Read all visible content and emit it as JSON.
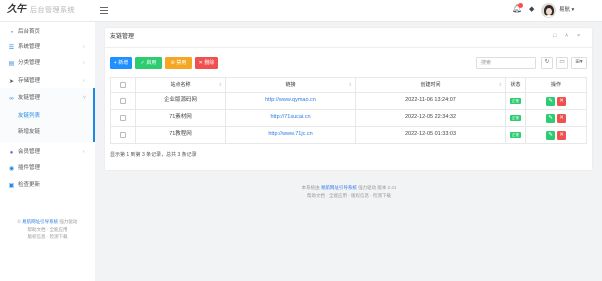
{
  "app": {
    "logo_text": "久午",
    "title": "后台管理系统"
  },
  "header": {
    "menu_icon": "hamburger-icon",
    "notification_icon": "bell-icon",
    "theme_icon": "skin-icon",
    "user_name": "易航",
    "user_caret": "▾"
  },
  "sidebar": {
    "items": [
      {
        "label": "后台首页",
        "icon": "dashboard-icon"
      },
      {
        "label": "系统管理",
        "icon": "sliders-icon"
      },
      {
        "label": "分类管理",
        "icon": "list-icon"
      },
      {
        "label": "存储管理",
        "icon": "send-icon"
      },
      {
        "label": "友链管理",
        "icon": "link-icon",
        "expanded": true,
        "children": [
          {
            "label": "友链列表",
            "active": true
          },
          {
            "label": "新增友链"
          }
        ]
      },
      {
        "label": "会员管理",
        "icon": "users-icon"
      },
      {
        "label": "插件管理",
        "icon": "plugin-icon"
      },
      {
        "label": "检查更新",
        "icon": "update-icon"
      }
    ],
    "footer": {
      "copyright": "©",
      "brand": "易航网址引导系统",
      "powered": "强力驱动",
      "links_1": "帮助文档 · 全能应用",
      "links_2": "版权信息 · 检测下载"
    }
  },
  "panel": {
    "title": "友链管理"
  },
  "toolbar": {
    "add": "新增",
    "enable": "启用",
    "disable": "禁用",
    "delete": "删除",
    "search_placeholder": "搜索"
  },
  "table": {
    "columns": [
      "站点名称",
      "链接",
      "创建时间",
      "状态",
      "操作"
    ],
    "rows": [
      {
        "name": "企业版源码网",
        "url": "http://www.qymao.cn",
        "created": "2022-11-06 13:24:07",
        "status": "正常"
      },
      {
        "name": "71素材网",
        "url": "http://71sucai.cn",
        "created": "2022-12-05 22:34:32",
        "status": "正常"
      },
      {
        "name": "71教程网",
        "url": "http://www.71jc.cn",
        "created": "2022-12-05 01:33:03",
        "status": "正常"
      }
    ]
  },
  "pagination": {
    "summary": "显示第 1 到第 3 条记录，总共 3 条记录"
  },
  "footer": {
    "prefix": "本系统由",
    "brand": "易航网址引导系统",
    "suffix": "强力驱动 版本 2.41",
    "links": "帮助文档 · 全能应用 · 版权信息 · 检测下载"
  },
  "colors": {
    "primary": "#1e90ff",
    "success": "#2ecc71",
    "warning": "#f5a623",
    "danger": "#f0504f",
    "link": "#2c7be5",
    "sidebar_active": "#1e88e5"
  }
}
